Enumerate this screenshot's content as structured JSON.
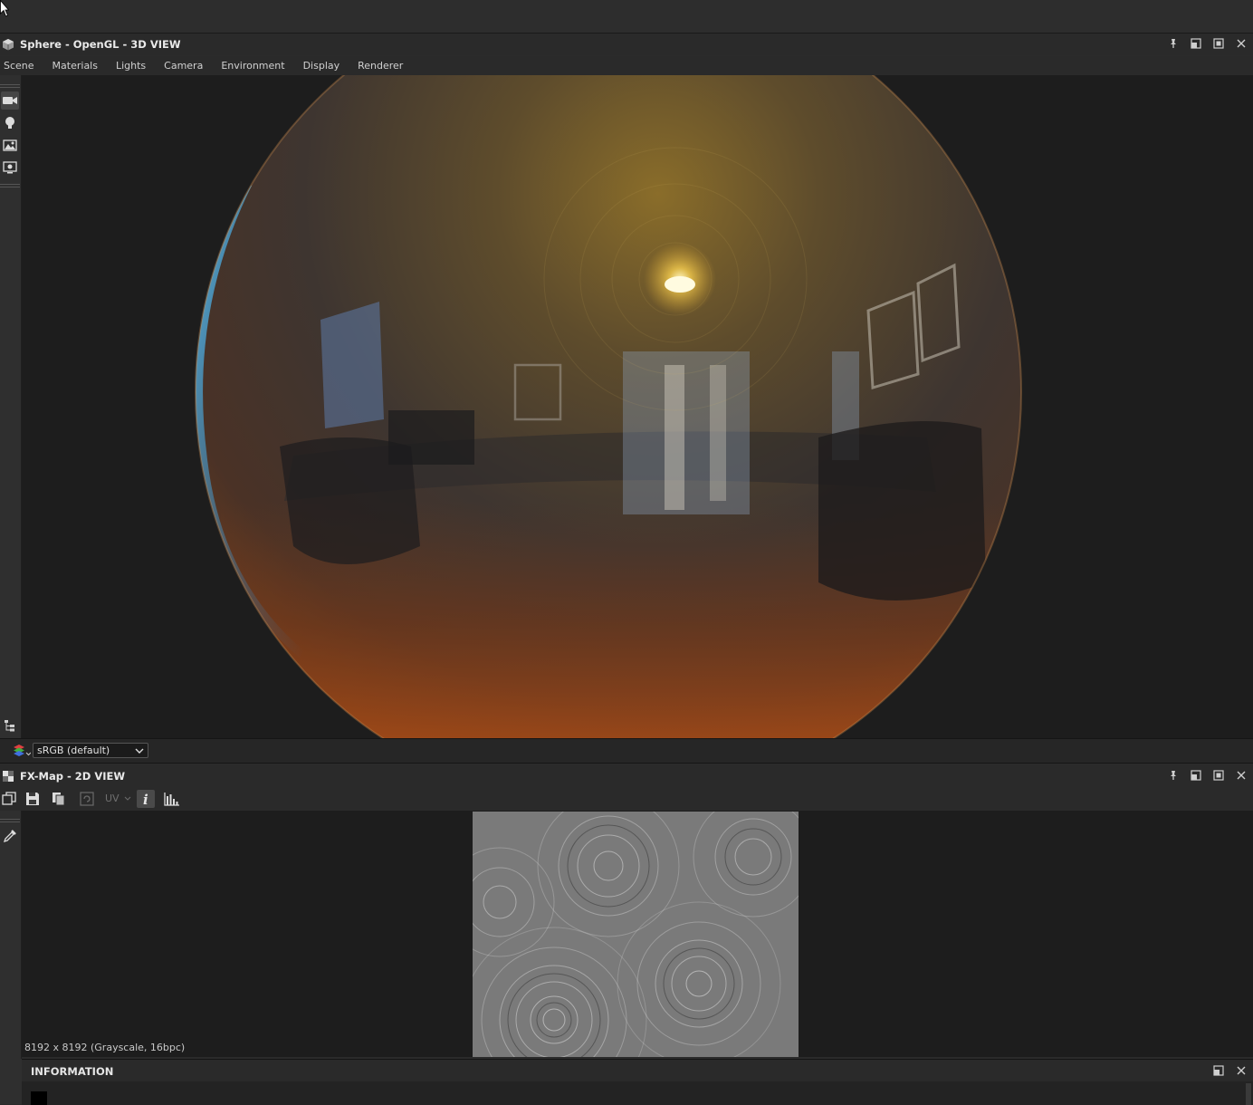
{
  "view3d": {
    "title": "Sphere - OpenGL - 3D VIEW",
    "menu": [
      "Scene",
      "Materials",
      "Lights",
      "Camera",
      "Environment",
      "Display",
      "Renderer"
    ],
    "left_tools": [
      "camera-icon",
      "light-bulb-icon",
      "environment-icon",
      "display-settings-icon"
    ],
    "color_space": "sRGB (default)"
  },
  "view2d": {
    "title": "FX-Map - 2D VIEW",
    "uv_label": "UV",
    "image_info": "8192 x 8192 (Grayscale, 16bpc)"
  },
  "information": {
    "title": "INFORMATION"
  },
  "colors": {
    "panel_bg": "#2a2a2a",
    "viewport_bg": "#1d1d1d",
    "text": "#d6d6d6"
  }
}
